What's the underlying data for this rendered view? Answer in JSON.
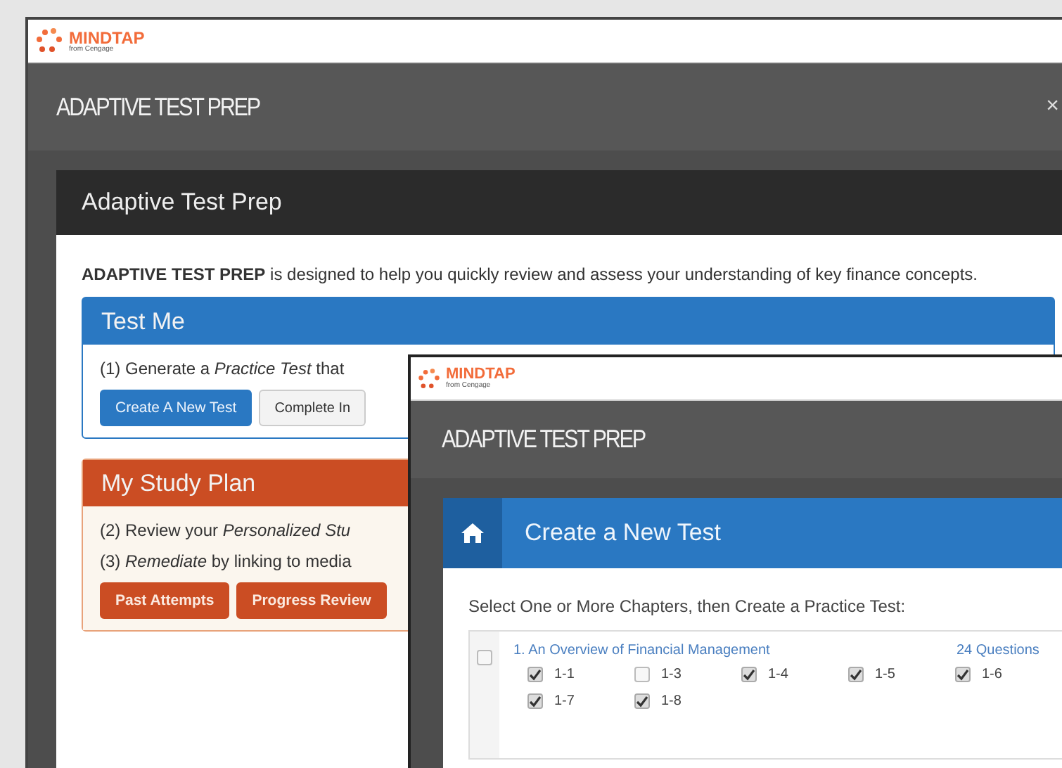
{
  "back_window": {
    "logo": {
      "name": "MINDTAP",
      "tagline": "from Cengage"
    },
    "title": "ADAPTIVE TEST PREP",
    "close": "×",
    "panel": {
      "title": "Adaptive Test Prep",
      "intro": "**ADAPTIVE TEST PREP** is designed to help you quickly review and assess your understanding of key finance concepts.",
      "cards": [
        {
          "kind": "test",
          "title": "Test Me",
          "lines": [
            "(1) Generate a *Practice Test* that"
          ],
          "buttons": [
            {
              "label": "Create A New Test",
              "primary": true
            },
            {
              "label": "Complete In",
              "primary": false
            }
          ]
        },
        {
          "kind": "plan",
          "title": "My Study Plan",
          "lines": [
            "(2) Review your *Personalized Stu*",
            "(3) *Remediate* by linking to media"
          ],
          "buttons": [
            {
              "label": "Past Attempts",
              "primary": true
            },
            {
              "label": "Progress Review",
              "primary": true
            }
          ]
        }
      ]
    }
  },
  "front_window": {
    "logo": {
      "name": "MINDTAP",
      "tagline": "from Cengage"
    },
    "title": "ADAPTIVE TEST PREP",
    "section_title": "Create a New Test",
    "instruction": "Select One or More Chapters, then Create a Practice Test:",
    "chapters": [
      {
        "title": "1. An Overview of Financial Management",
        "count": "24 Questions",
        "checked": false,
        "sections": [
          {
            "label": "1-1",
            "checked": true
          },
          {
            "label": "1-3",
            "checked": false
          },
          {
            "label": "1-4",
            "checked": true
          },
          {
            "label": "1-5",
            "checked": true
          },
          {
            "label": "1-6",
            "checked": true
          },
          {
            "label": "1-7",
            "checked": true
          },
          {
            "label": "1-8",
            "checked": true
          }
        ]
      }
    ]
  }
}
